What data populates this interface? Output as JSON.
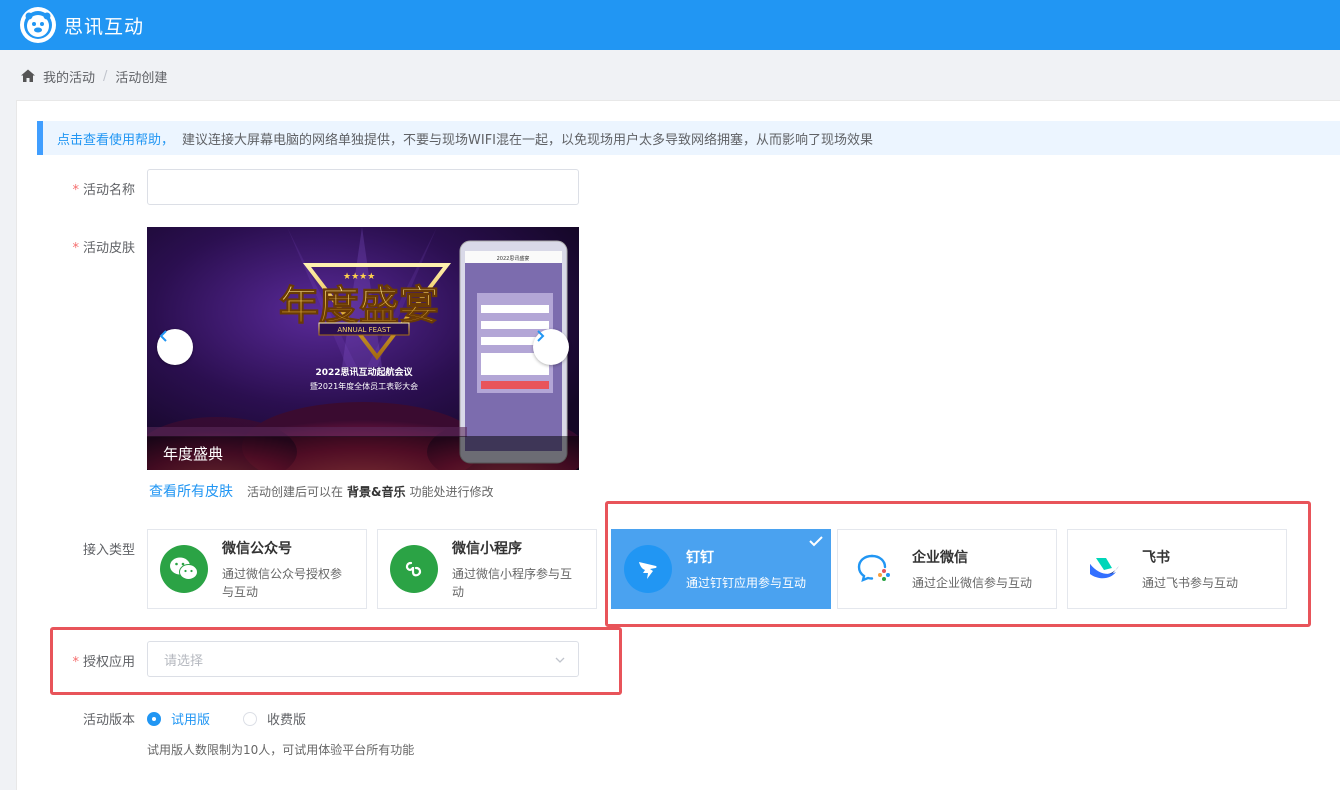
{
  "header": {
    "app_name": "思讯互动",
    "logo_icon": "tiger-logo-icon",
    "bg_color": "#2196f3"
  },
  "breadcrumb": {
    "items": [
      "我的活动",
      "活动创建"
    ],
    "separator": "/"
  },
  "notice": {
    "link_text": "点击查看使用帮助，",
    "message": "建议连接大屏幕电脑的网络单独提供，不要与现场WIFI混在一起，以免现场用户太多导致网络拥塞，从而影响了现场效果"
  },
  "form": {
    "name_label": "活动名称",
    "name_value": "",
    "skin_label": "活动皮肤",
    "skin": {
      "caption": "年度盛典",
      "title_art": "年度盛宴",
      "subtitle_art": "ANNUAL FEAST",
      "line1": "2022思讯互动起航会议",
      "line2": "暨2021年度全体员工表彰大会",
      "phone_title": "2022思讯盛宴"
    },
    "skin_link": "查看所有皮肤",
    "skin_hint_pre": "活动创建后可以在",
    "skin_hint_bold": "背景&音乐",
    "skin_hint_post": "功能处进行修改",
    "access_label": "接入类型",
    "access_types": [
      {
        "title": "微信公众号",
        "desc": "通过微信公众号授权参与互动",
        "icon": "wechat-icon",
        "color": "#2ba345",
        "selected": false
      },
      {
        "title": "微信小程序",
        "desc": "通过微信小程序参与互动",
        "icon": "miniprogram-icon",
        "color": "#2ba345",
        "selected": false
      },
      {
        "title": "钉钉",
        "desc": "通过钉钉应用参与互动",
        "icon": "dingtalk-icon",
        "color": "#2196f3",
        "selected": true
      },
      {
        "title": "企业微信",
        "desc": "通过企业微信参与互动",
        "icon": "wecom-icon",
        "color": "#2196f3",
        "selected": false
      },
      {
        "title": "飞书",
        "desc": "通过飞书参与互动",
        "icon": "feishu-icon",
        "color": "#1f3d8b",
        "selected": false
      }
    ],
    "auth_label": "授权应用",
    "auth_placeholder": "请选择",
    "version_label": "活动版本",
    "versions": [
      {
        "label": "试用版",
        "selected": true
      },
      {
        "label": "收费版",
        "selected": false
      }
    ],
    "version_hint": "试用版人数限制为10人，可试用体验平台所有功能"
  },
  "highlight_color": "#e8545a"
}
